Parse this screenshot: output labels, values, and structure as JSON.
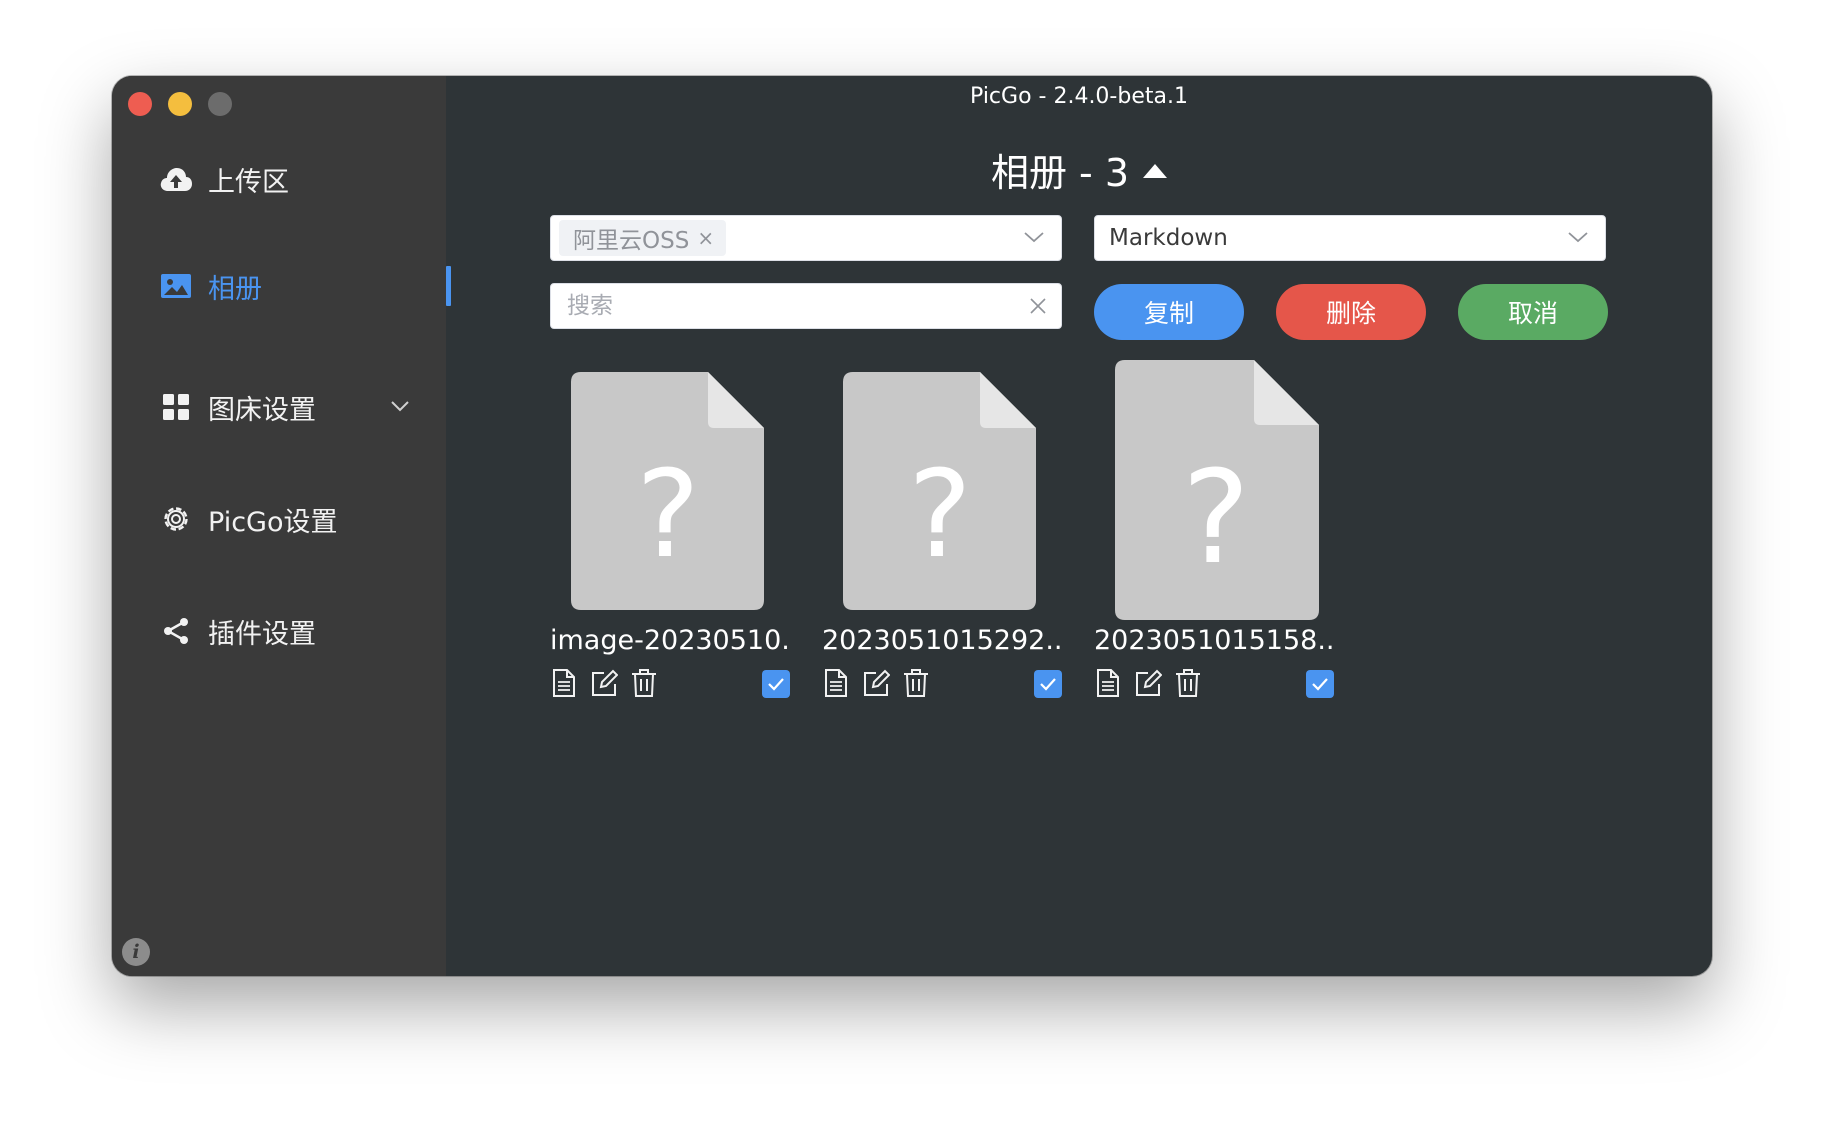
{
  "window": {
    "title": "PicGo - 2.4.0-beta.1"
  },
  "sidebar": {
    "items": [
      {
        "label": "上传区",
        "icon": "cloud-upload-icon"
      },
      {
        "label": "相册",
        "icon": "image-icon",
        "active": true
      },
      {
        "label": "图床设置",
        "icon": "grid-icon",
        "has_submenu": true
      },
      {
        "label": "PicGo设置",
        "icon": "gear-icon"
      },
      {
        "label": "插件设置",
        "icon": "share-icon"
      }
    ],
    "info_icon": "i"
  },
  "gallery": {
    "heading": "相册 - 3",
    "picbed_filter": {
      "tag": "阿里云OSS",
      "tag_close": "×"
    },
    "format_select": {
      "value": "Markdown"
    },
    "search": {
      "placeholder": "搜索",
      "value": ""
    },
    "buttons": {
      "copy": "复制",
      "delete": "删除",
      "cancel": "取消"
    },
    "items": [
      {
        "name": "image-20230510...",
        "checked": true
      },
      {
        "name": "2023051015292...",
        "checked": true
      },
      {
        "name": "2023051015158...",
        "checked": true
      }
    ]
  },
  "colors": {
    "accent": "#4a94f0",
    "danger": "#e5564a",
    "success": "#5aaa63",
    "sidebar_bg": "#3a3a3a",
    "main_bg": "#2e3437"
  }
}
